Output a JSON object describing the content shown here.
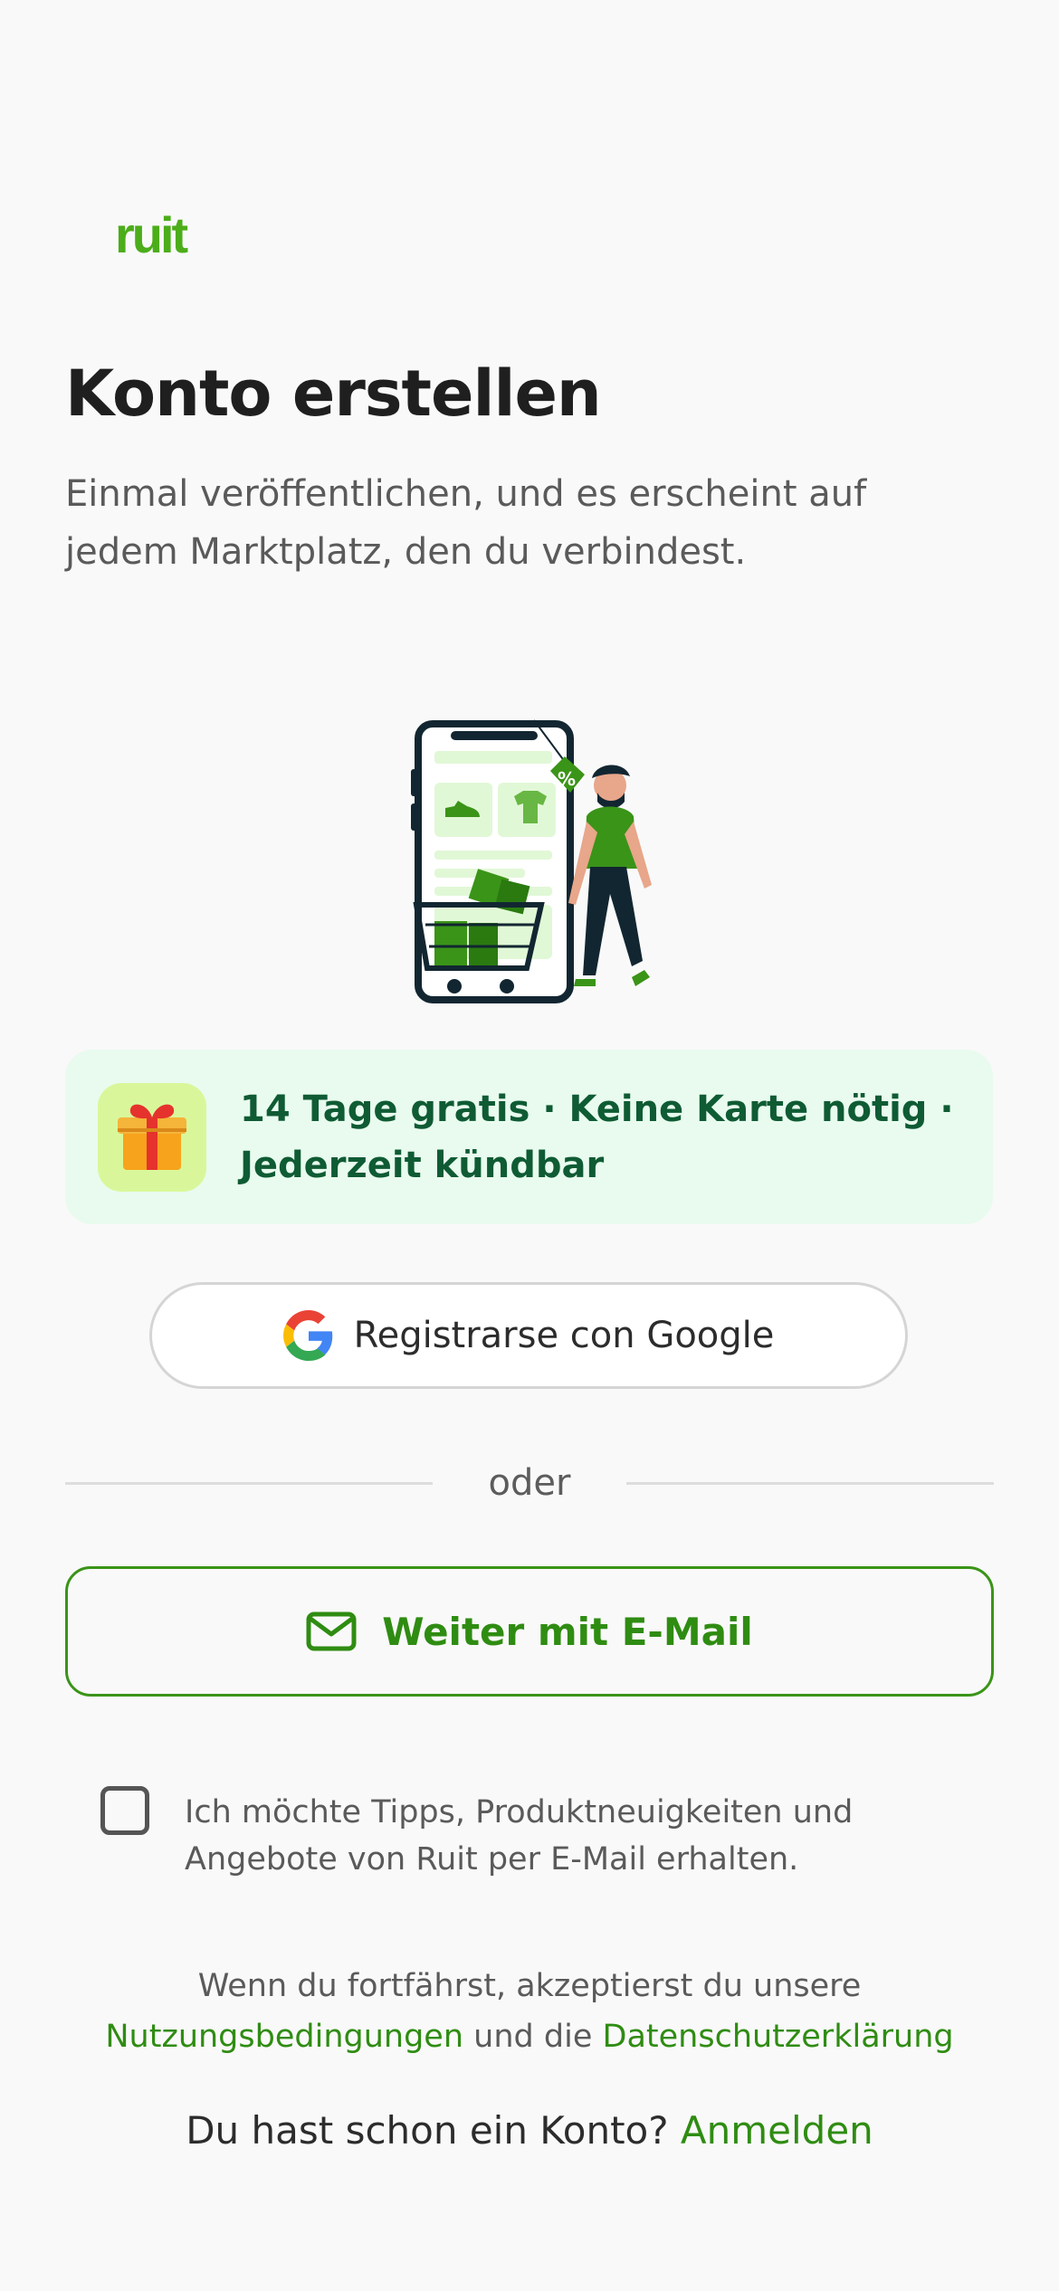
{
  "brand": {
    "logo_text": "ruit",
    "accent_color": "#4cad1a",
    "link_color": "#2f8c12"
  },
  "header": {
    "title": "Konto erstellen",
    "subtitle": "Einmal veröffentlichen, und es erscheint auf jedem Marktplatz, den du verbindest."
  },
  "illustration": {
    "icon": "shopping-phone-illustration"
  },
  "promo": {
    "icon": "gift-icon",
    "text": "14 Tage gratis · Keine Karte nötig · Jederzeit kündbar"
  },
  "auth": {
    "google_label": "Registrarse con Google",
    "google_icon": "google-icon",
    "divider_label": "oder",
    "email_label": "Weiter mit E-Mail",
    "email_icon": "mail-icon"
  },
  "consent": {
    "checked": false,
    "label": "Ich möchte Tipps, Produktneuigkeiten und Angebote von Ruit per E-Mail erhalten."
  },
  "legal": {
    "prefix": "Wenn du fortfährst, akzeptierst du unsere",
    "terms_link": "Nutzungsbedingungen",
    "middle": "und die",
    "privacy_link": "Datenschutzerklärung"
  },
  "signin": {
    "prompt": "Du hast schon ein Konto?",
    "link": "Anmelden"
  }
}
